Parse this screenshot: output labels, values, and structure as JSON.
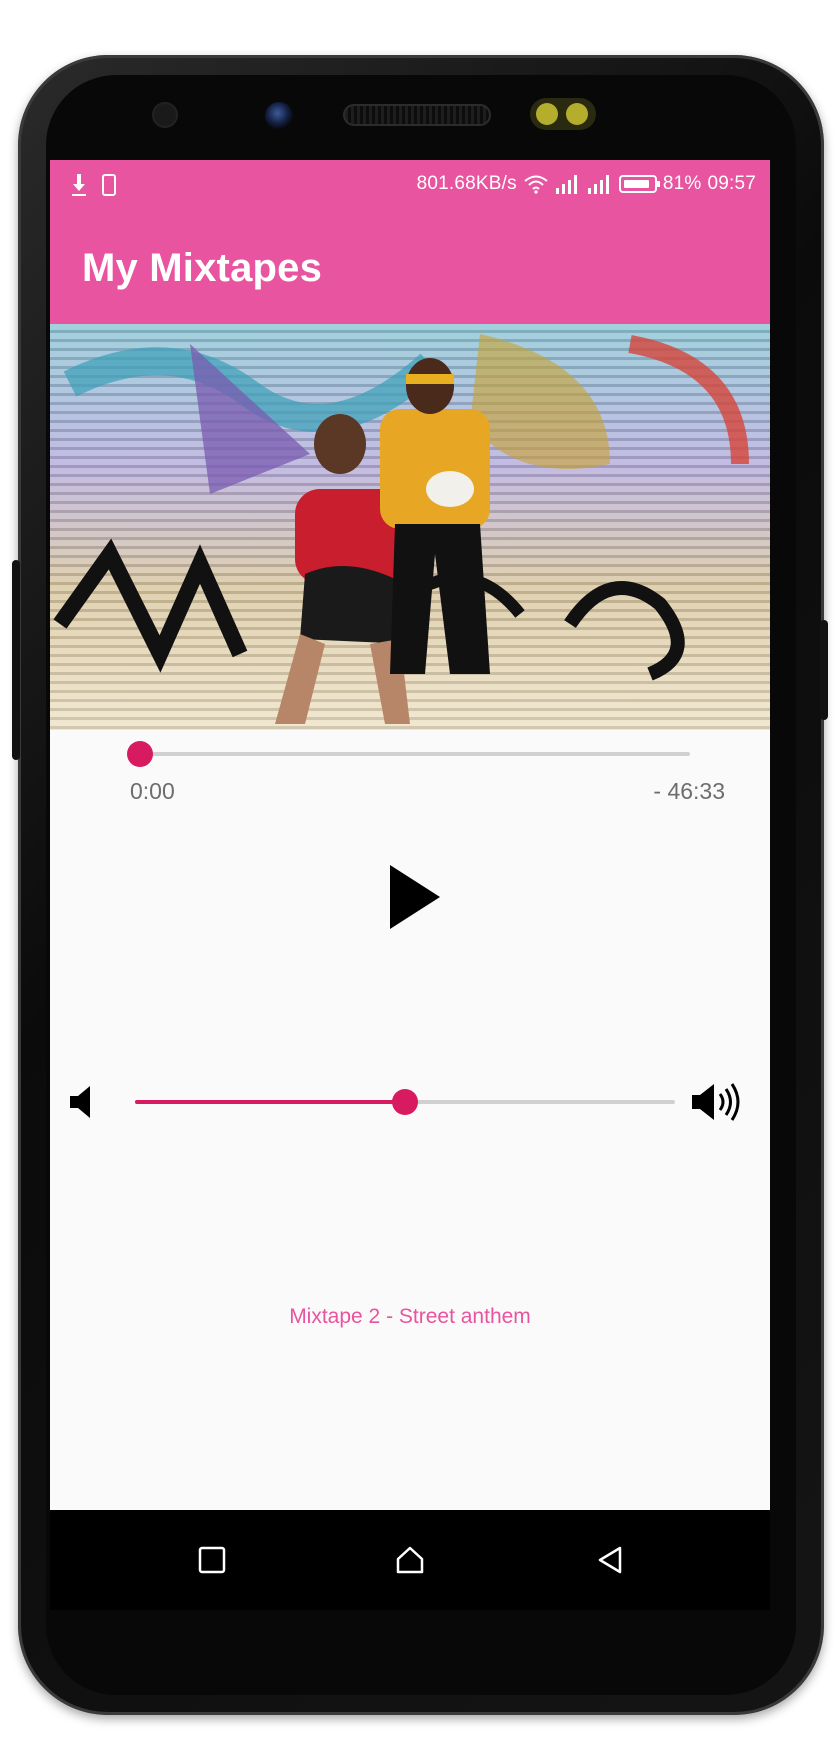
{
  "status_bar": {
    "network_speed": "801.68KB/s",
    "battery_percent": "81%",
    "time": "09:57",
    "icons": [
      "download-icon",
      "phone-check-icon",
      "wifi-icon",
      "signal-icon",
      "signal-icon",
      "battery-icon"
    ]
  },
  "app_bar": {
    "title": "My Mixtapes"
  },
  "player": {
    "elapsed": "0:00",
    "remaining": "- 46:33",
    "progress_fraction": 0.0,
    "play_icon": "play-icon",
    "volume_fraction": 0.5,
    "volume_low_icon": "volume-low-icon",
    "volume_high_icon": "volume-high-icon",
    "track_title": "Mixtape 2 - Street anthem"
  },
  "nav_bar": {
    "icons": [
      "recent-apps-icon",
      "home-icon",
      "back-icon"
    ]
  },
  "colors": {
    "primary": "#e8549f",
    "accent": "#d81b60",
    "background": "#fafafa"
  }
}
